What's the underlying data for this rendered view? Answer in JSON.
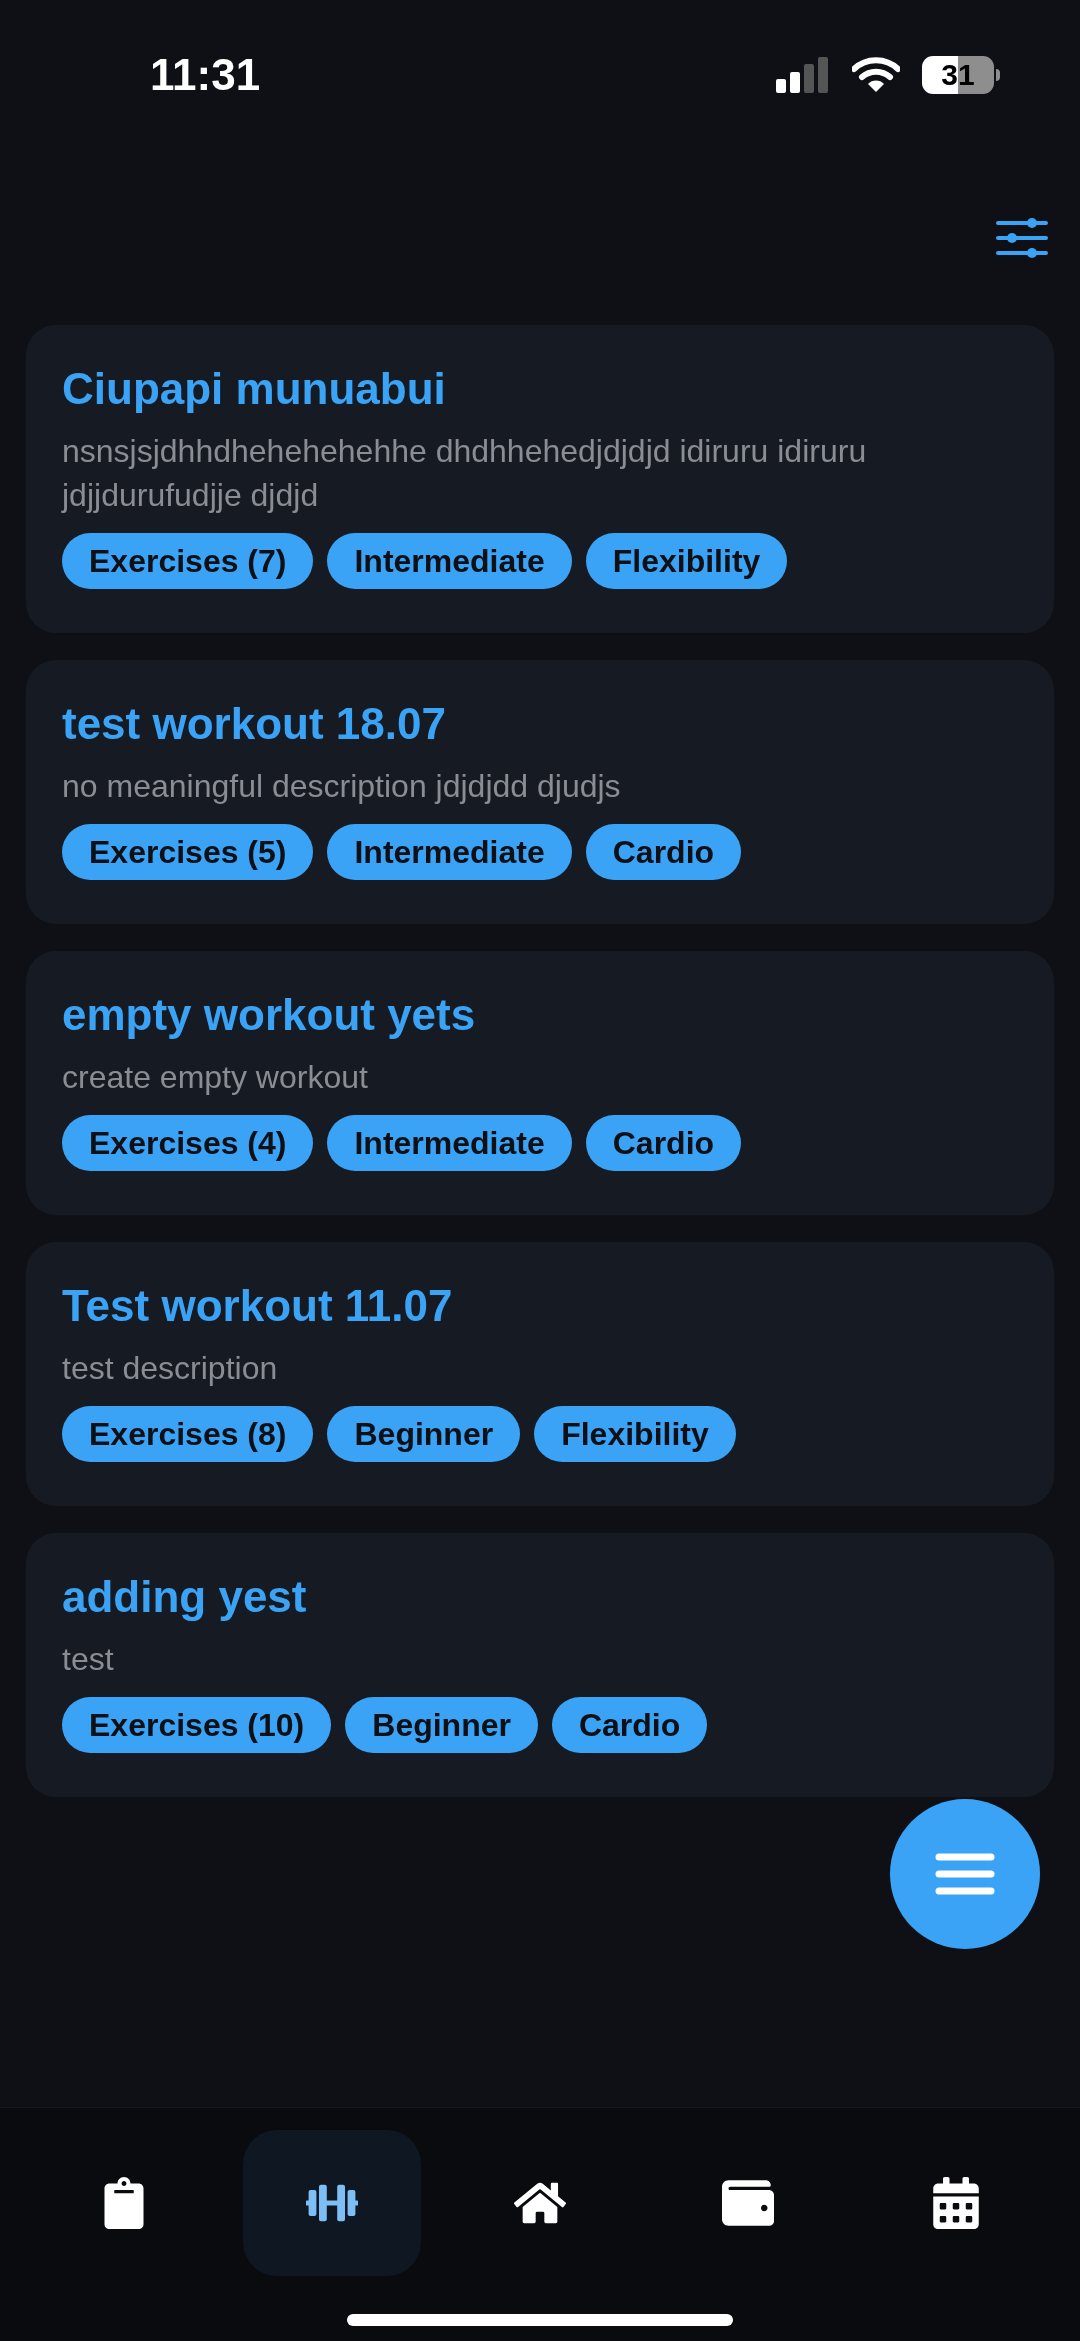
{
  "status_bar": {
    "time": "11:31",
    "battery": "31"
  },
  "workouts": [
    {
      "title": "Ciupapi munuabui",
      "description": "nsnsjsjdhhdhehehehehhe dhdhhehedjdjdjd idiruru idiruru jdjjdurufudjje djdjd",
      "tags": [
        "Exercises (7)",
        "Intermediate",
        "Flexibility"
      ]
    },
    {
      "title": "test workout 18.07",
      "description": "no meaningful description jdjdjdd djudjs",
      "tags": [
        "Exercises (5)",
        "Intermediate",
        "Cardio"
      ]
    },
    {
      "title": "empty workout yets",
      "description": "create empty workout",
      "tags": [
        "Exercises (4)",
        "Intermediate",
        "Cardio"
      ]
    },
    {
      "title": "Test workout 11.07",
      "description": "test description",
      "tags": [
        "Exercises (8)",
        "Beginner",
        "Flexibility"
      ]
    },
    {
      "title": "adding yest",
      "description": "test",
      "tags": [
        "Exercises (10)",
        "Beginner",
        "Cardio"
      ]
    }
  ],
  "tab_bar": [
    {
      "kind": "clipboard",
      "selected": false
    },
    {
      "kind": "dumbbell",
      "selected": true
    },
    {
      "kind": "home",
      "selected": false
    },
    {
      "kind": "wallet",
      "selected": false
    },
    {
      "kind": "calendar",
      "selected": false
    }
  ]
}
